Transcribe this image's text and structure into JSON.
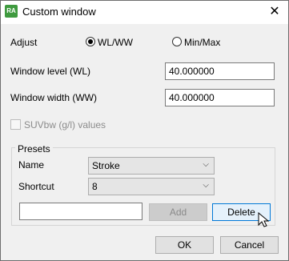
{
  "window": {
    "title": "Custom window",
    "close_symbol": "✕",
    "app_icon_text": "RA"
  },
  "adjust": {
    "label": "Adjust",
    "options": [
      {
        "label": "WL/WW",
        "selected": true
      },
      {
        "label": "Min/Max",
        "selected": false
      }
    ]
  },
  "fields": {
    "window_level": {
      "label": "Window level (WL)",
      "value": "40.000000"
    },
    "window_width": {
      "label": "Window width (WW)",
      "value": "40.000000"
    }
  },
  "suv": {
    "label": "SUVbw (g/l) values",
    "checked": false,
    "enabled": false
  },
  "presets": {
    "title": "Presets",
    "name_label": "Name",
    "name_value": "Stroke",
    "shortcut_label": "Shortcut",
    "shortcut_value": "8",
    "new_name_value": "",
    "add_label": "Add",
    "delete_label": "Delete"
  },
  "footer": {
    "ok_label": "OK",
    "cancel_label": "Cancel"
  },
  "icons": {
    "app": "app-icon",
    "close": "close-icon",
    "dropdown": "chevron-down-icon",
    "cursor": "mouse-pointer-icon"
  },
  "colors": {
    "dialog_bg": "#f0f0f0",
    "focus_border": "#0078d7",
    "focus_bg": "#e5f1fb",
    "app_icon_bg": "#3f9a3f"
  }
}
